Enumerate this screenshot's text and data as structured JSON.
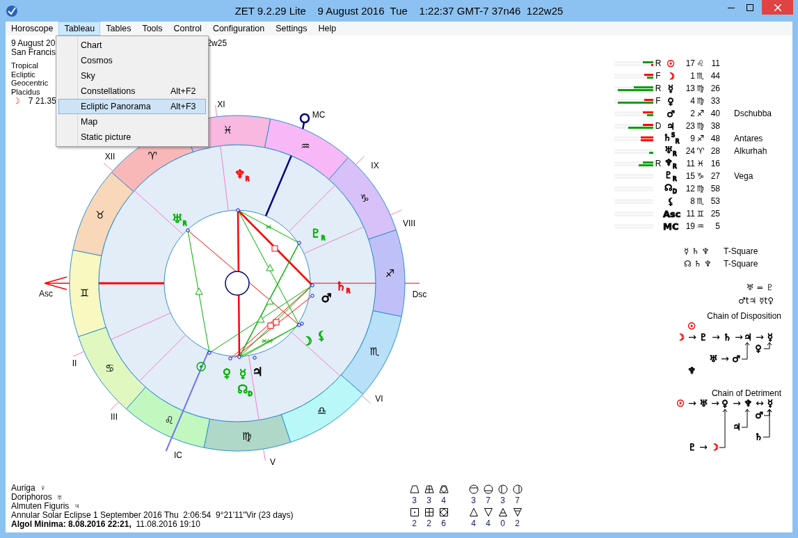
{
  "window": {
    "title": "ZET 9.2.29 Lite    9 August 2016  Tue    1:22:37 GMT-7 37n46  122w25"
  },
  "menu_bar": [
    {
      "label": "Horoscope",
      "selected": false
    },
    {
      "label": "Tableau",
      "selected": true
    },
    {
      "label": "Tables",
      "selected": false
    },
    {
      "label": "Tools",
      "selected": false
    },
    {
      "label": "Control",
      "selected": false
    },
    {
      "label": "Configuration",
      "selected": false
    },
    {
      "label": "Settings",
      "selected": false
    },
    {
      "label": "Help",
      "selected": false
    }
  ],
  "open_menu": {
    "items": [
      {
        "label": "Chart",
        "selected": false
      },
      {
        "label": "Cosmos",
        "selected": false
      },
      {
        "label": "Sky",
        "selected": false
      },
      {
        "label": "Constellations",
        "shortcut": "Alt+F2",
        "selected": false
      },
      {
        "label": "Ecliptic Panorama",
        "shortcut": "Alt+F3",
        "selected": true
      },
      {
        "label": "Map",
        "selected": false
      },
      {
        "label": "Static picture",
        "selected": false
      }
    ]
  },
  "header_info": {
    "date_fragment": "9 August 20",
    "coordinates_fragment": "2w25",
    "place_fragment": "San Francis"
  },
  "settings": [
    "Tropical",
    "Ecliptic",
    "Geocentric",
    "Placidus"
  ],
  "moon": {
    "glyph": "☽",
    "value": "7 21.35"
  },
  "chart": {
    "zodiac": [
      {
        "glyph": "♈",
        "color": "#f8b8b8"
      },
      {
        "glyph": "♉",
        "color": "#f8d8b8"
      },
      {
        "glyph": "♊",
        "color": "#f8f8c0"
      },
      {
        "glyph": "♋",
        "color": "#e0f8c0"
      },
      {
        "glyph": "♌",
        "color": "#c0f8c0"
      },
      {
        "glyph": "♍",
        "color": "#b0d8c8"
      },
      {
        "glyph": "♎",
        "color": "#b8f8f8"
      },
      {
        "glyph": "♏",
        "color": "#b8e0f8"
      },
      {
        "glyph": "♐",
        "color": "#c0c0f8"
      },
      {
        "glyph": "♑",
        "color": "#d8c0f8"
      },
      {
        "glyph": "♒",
        "color": "#f8b8f8"
      },
      {
        "glyph": "♓",
        "color": "#f8b8e0"
      }
    ],
    "house_labels": [
      "XI",
      "XII",
      "II",
      "III",
      "V",
      "VI",
      "VIII",
      "IX"
    ],
    "angle_labels": [
      "Asc",
      "Dsc",
      "MC",
      "IC"
    ],
    "planets": [
      {
        "glyph": "♆$_{R}$",
        "color": "#ff0000"
      },
      {
        "glyph": "♅$_{R}$",
        "color": "#00b000"
      },
      {
        "glyph": "♇$_{R}$",
        "color": "#00b000"
      },
      {
        "glyph": "♄$_{R}$",
        "color": "#ff0000"
      },
      {
        "glyph": "♂",
        "color": "#000000"
      },
      {
        "glyph": "⚸",
        "color": "#00b000"
      },
      {
        "glyph": "☽",
        "color": "#00b000"
      },
      {
        "glyph": "☉",
        "color": "#00b000"
      },
      {
        "glyph": "♀",
        "color": "#00b000"
      },
      {
        "glyph": "☿",
        "color": "#00b000"
      },
      {
        "glyph": "♃",
        "color": "#000000"
      },
      {
        "glyph": "☊$_{D}$",
        "color": "#00b000"
      }
    ]
  },
  "planet_table": [
    {
      "status": "R",
      "glyph": "☉",
      "color": "#ff0000",
      "degree": "17",
      "sign": "♌",
      "minutes": "11",
      "upper": {
        "color": "#00a000",
        "level": 0.27
      },
      "lower": {
        "color": "#ff0000",
        "level": 0.06
      }
    },
    {
      "status": "F",
      "glyph": "☽",
      "color": "#ff0000",
      "degree": "1",
      "sign": "♏",
      "minutes": "44",
      "upper": {
        "color": "#ff0000",
        "level": 0.23
      },
      "lower": {
        "color": "#00a000",
        "level": 0.16
      }
    },
    {
      "status": "R",
      "glyph": "☿",
      "color": "#000000",
      "degree": "13",
      "sign": "♍",
      "minutes": "26",
      "upper": {
        "color": "#00a000",
        "level": 0.5
      },
      "lower": {
        "color": "#00a000",
        "level": 0.91
      }
    },
    {
      "status": "F",
      "glyph": "♀",
      "color": "#000000",
      "degree": "4",
      "sign": "♍",
      "minutes": "33",
      "upper": {
        "color": "#ff0000",
        "level": 0.23
      },
      "lower": {
        "color": "#00a000",
        "level": 0.91
      }
    },
    {
      "glyph": "♂",
      "color": "#000000",
      "degree": "2",
      "sign": "♐",
      "minutes": "40",
      "star": "Dschubba",
      "upper": {
        "color": "#ff0000",
        "level": 0.27
      },
      "lower": {
        "color": "#00a000",
        "level": 0.16
      }
    },
    {
      "status": "D",
      "glyph": "♃",
      "color": "#000000",
      "degree": "23",
      "sign": "♍",
      "minutes": "38",
      "upper": {
        "color": "#ff0000",
        "level": 0.27
      },
      "lower": {
        "color": "#00a000",
        "level": 0.64
      }
    },
    {
      "glyph": "♄$^{S}$$_{R}$",
      "color": "#000000",
      "degree": "9",
      "sign": "♐",
      "minutes": "48",
      "star": "Antares",
      "upper": {
        "color": "#ff0000",
        "level": 0.32
      },
      "lower": {
        "color": "#ff0000",
        "level": 0.32
      }
    },
    {
      "glyph": "♅$_{R}$",
      "color": "#000000",
      "degree": "24",
      "sign": "♈",
      "minutes": "28",
      "star": "Alkurhah",
      "lower": {
        "color": "#00a000",
        "level": 0.1
      }
    },
    {
      "status": "R",
      "glyph": "♆$_{R}$",
      "color": "#000000",
      "degree": "11",
      "sign": "♓",
      "minutes": "16",
      "upper": {
        "color": "#00a000",
        "level": 0.27
      },
      "lower": {
        "color": "#00a000",
        "level": 0.38
      }
    },
    {
      "glyph": "♇$_{R}$",
      "color": "#000000",
      "degree": "15",
      "sign": "♑",
      "minutes": "27",
      "star": "Vega"
    },
    {
      "glyph": "☊$_{D}$",
      "color": "#000000",
      "degree": "12",
      "sign": "♍",
      "minutes": "58"
    },
    {
      "glyph": "⚸",
      "color": "#000000",
      "degree": "8",
      "sign": "♏",
      "minutes": "53"
    },
    {
      "glyph": "Asc",
      "color": "#000000",
      "degree": "11",
      "sign": "♊",
      "minutes": "25"
    },
    {
      "glyph": "MC",
      "color": "#000000",
      "degree": "19",
      "sign": "♒",
      "minutes": "5"
    }
  ],
  "patterns": [
    {
      "glyphs": "☿ ♄ ♆",
      "name": "T-Square"
    },
    {
      "glyphs": "☊ ♄ ♆",
      "name": "T-Square"
    }
  ],
  "relations": [
    "♅ = ♇",
    "♂t♃ ☿t♀"
  ],
  "chain_of_disposition": {
    "title": "Chain of Disposition",
    "items": [
      {
        "kind": "planet",
        "text": "☉",
        "color": "#ff0000"
      },
      {
        "kind": "planet",
        "text": "☽",
        "color": "#ff0000"
      },
      {
        "kind": "arrow",
        "text": "→"
      },
      {
        "kind": "planet",
        "text": "♇",
        "color": "#000000"
      },
      {
        "kind": "arrow",
        "text": "→"
      },
      {
        "kind": "planet",
        "text": "♄",
        "color": "#000000"
      },
      {
        "kind": "arrow",
        "text": "→"
      },
      {
        "kind": "planet",
        "text": "♃",
        "color": "#000000"
      },
      {
        "kind": "arrow",
        "text": "→"
      },
      {
        "kind": "planet",
        "text": "☿",
        "color": "#000000"
      },
      {
        "kind": "planet",
        "text": "♀",
        "color": "#000000"
      },
      {
        "kind": "planet",
        "text": "♅",
        "color": "#000000"
      },
      {
        "kind": "arrow",
        "text": "→"
      },
      {
        "kind": "planet",
        "text": "♂",
        "color": "#000000"
      },
      {
        "kind": "planet",
        "text": "♆",
        "color": "#000000"
      }
    ]
  },
  "chain_of_detriment": {
    "title": "Chain of Detriment",
    "items": [
      {
        "kind": "planet",
        "text": "☉",
        "color": "#ff0000"
      },
      {
        "kind": "arrow",
        "text": "→"
      },
      {
        "kind": "planet",
        "text": "♅",
        "color": "#000000"
      },
      {
        "kind": "arrow",
        "text": "→"
      },
      {
        "kind": "planet",
        "text": "♀",
        "color": "#000000"
      },
      {
        "kind": "arrow",
        "text": "→"
      },
      {
        "kind": "planet",
        "text": "♆",
        "color": "#000000"
      },
      {
        "kind": "arrow",
        "text": "↔"
      },
      {
        "kind": "planet",
        "text": "☿",
        "color": "#000000"
      },
      {
        "kind": "planet",
        "text": "♂",
        "color": "#000000"
      },
      {
        "kind": "planet",
        "text": "♃",
        "color": "#000000"
      },
      {
        "kind": "planet",
        "text": "♄",
        "color": "#000000"
      },
      {
        "kind": "planet",
        "text": "♇",
        "color": "#000000"
      },
      {
        "kind": "arrow",
        "text": "→"
      },
      {
        "kind": "planet",
        "text": "☽",
        "color": "#ff0000"
      }
    ]
  },
  "notes": [
    "Auriga  ♀",
    "Doriphoros  ♅",
    "Almuten Figuris  ♃",
    "Annular Solar Eclipse 1 September 2016 Thu  2:06:54  9°21'11\"Vir (23 days)",
    "**Algol Minima: 8.08.2016 22:21,**  11.08.2016 19:10"
  ],
  "element_counts": [
    {
      "kind": "trapezoid",
      "count": "3"
    },
    {
      "kind": "trapezoid_cross",
      "count": "3"
    },
    {
      "kind": "trapezoid_diamond",
      "count": "4"
    },
    {
      "kind": "circle_top",
      "count": "3"
    },
    {
      "kind": "circle_bottom",
      "count": "7"
    },
    {
      "kind": "circle_left",
      "count": "3"
    },
    {
      "kind": "circle_right",
      "count": "7"
    },
    {
      "kind": "square_dot",
      "count": "2"
    },
    {
      "kind": "square_cross",
      "count": "2"
    },
    {
      "kind": "square_diamond",
      "count": "6"
    },
    {
      "kind": "triangle_up",
      "count": "4"
    },
    {
      "kind": "triangle_down",
      "count": "4"
    },
    {
      "kind": "triangle_up_bar",
      "count": "0"
    },
    {
      "kind": "triangle_down_bar",
      "count": "2"
    }
  ]
}
